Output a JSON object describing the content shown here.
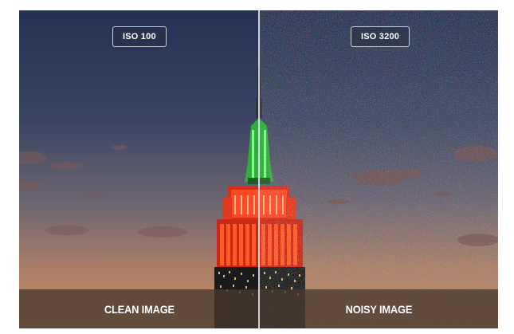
{
  "left_panel": {
    "iso_label": "ISO 100",
    "caption": "CLEAN IMAGE"
  },
  "right_panel": {
    "iso_label": "ISO 3200",
    "caption": "NOISY IMAGE"
  },
  "colors": {
    "sky_top": "#253150",
    "sky_mid": "#4a5067",
    "sky_horizon": "#c08a5f",
    "spire_green": "#3fd24a",
    "tower_red": "#ff3a1e",
    "caption_bar": "#48382e"
  }
}
